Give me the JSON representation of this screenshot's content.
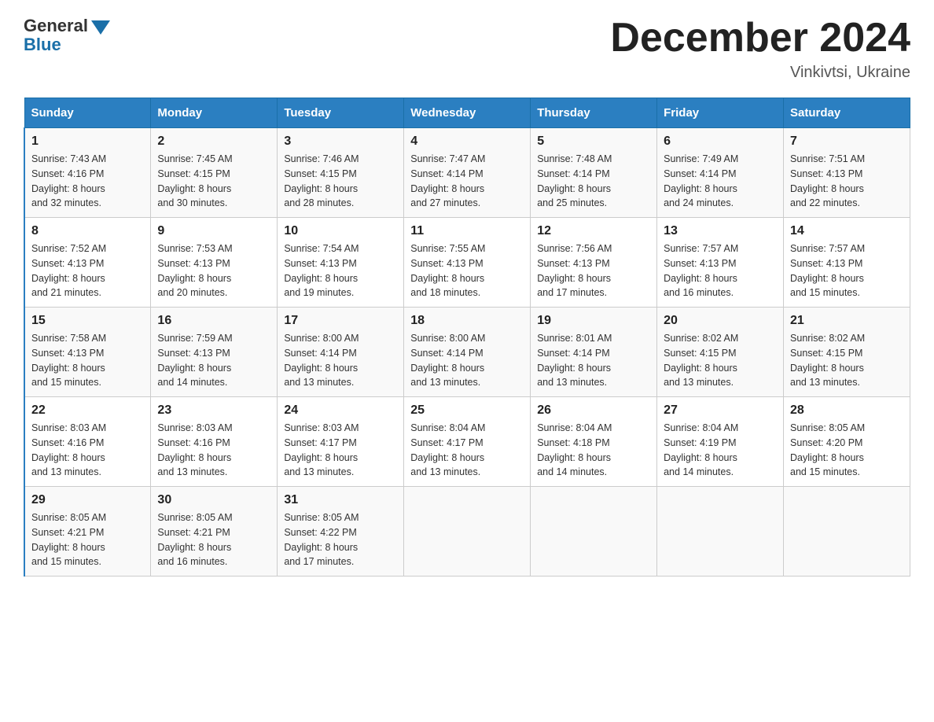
{
  "header": {
    "logo_general": "General",
    "logo_blue": "Blue",
    "month_title": "December 2024",
    "location": "Vinkivtsi, Ukraine"
  },
  "days_of_week": [
    "Sunday",
    "Monday",
    "Tuesday",
    "Wednesday",
    "Thursday",
    "Friday",
    "Saturday"
  ],
  "weeks": [
    [
      {
        "day": "1",
        "sunrise": "7:43 AM",
        "sunset": "4:16 PM",
        "daylight": "8 hours and 32 minutes."
      },
      {
        "day": "2",
        "sunrise": "7:45 AM",
        "sunset": "4:15 PM",
        "daylight": "8 hours and 30 minutes."
      },
      {
        "day": "3",
        "sunrise": "7:46 AM",
        "sunset": "4:15 PM",
        "daylight": "8 hours and 28 minutes."
      },
      {
        "day": "4",
        "sunrise": "7:47 AM",
        "sunset": "4:14 PM",
        "daylight": "8 hours and 27 minutes."
      },
      {
        "day": "5",
        "sunrise": "7:48 AM",
        "sunset": "4:14 PM",
        "daylight": "8 hours and 25 minutes."
      },
      {
        "day": "6",
        "sunrise": "7:49 AM",
        "sunset": "4:14 PM",
        "daylight": "8 hours and 24 minutes."
      },
      {
        "day": "7",
        "sunrise": "7:51 AM",
        "sunset": "4:13 PM",
        "daylight": "8 hours and 22 minutes."
      }
    ],
    [
      {
        "day": "8",
        "sunrise": "7:52 AM",
        "sunset": "4:13 PM",
        "daylight": "8 hours and 21 minutes."
      },
      {
        "day": "9",
        "sunrise": "7:53 AM",
        "sunset": "4:13 PM",
        "daylight": "8 hours and 20 minutes."
      },
      {
        "day": "10",
        "sunrise": "7:54 AM",
        "sunset": "4:13 PM",
        "daylight": "8 hours and 19 minutes."
      },
      {
        "day": "11",
        "sunrise": "7:55 AM",
        "sunset": "4:13 PM",
        "daylight": "8 hours and 18 minutes."
      },
      {
        "day": "12",
        "sunrise": "7:56 AM",
        "sunset": "4:13 PM",
        "daylight": "8 hours and 17 minutes."
      },
      {
        "day": "13",
        "sunrise": "7:57 AM",
        "sunset": "4:13 PM",
        "daylight": "8 hours and 16 minutes."
      },
      {
        "day": "14",
        "sunrise": "7:57 AM",
        "sunset": "4:13 PM",
        "daylight": "8 hours and 15 minutes."
      }
    ],
    [
      {
        "day": "15",
        "sunrise": "7:58 AM",
        "sunset": "4:13 PM",
        "daylight": "8 hours and 15 minutes."
      },
      {
        "day": "16",
        "sunrise": "7:59 AM",
        "sunset": "4:13 PM",
        "daylight": "8 hours and 14 minutes."
      },
      {
        "day": "17",
        "sunrise": "8:00 AM",
        "sunset": "4:14 PM",
        "daylight": "8 hours and 13 minutes."
      },
      {
        "day": "18",
        "sunrise": "8:00 AM",
        "sunset": "4:14 PM",
        "daylight": "8 hours and 13 minutes."
      },
      {
        "day": "19",
        "sunrise": "8:01 AM",
        "sunset": "4:14 PM",
        "daylight": "8 hours and 13 minutes."
      },
      {
        "day": "20",
        "sunrise": "8:02 AM",
        "sunset": "4:15 PM",
        "daylight": "8 hours and 13 minutes."
      },
      {
        "day": "21",
        "sunrise": "8:02 AM",
        "sunset": "4:15 PM",
        "daylight": "8 hours and 13 minutes."
      }
    ],
    [
      {
        "day": "22",
        "sunrise": "8:03 AM",
        "sunset": "4:16 PM",
        "daylight": "8 hours and 13 minutes."
      },
      {
        "day": "23",
        "sunrise": "8:03 AM",
        "sunset": "4:16 PM",
        "daylight": "8 hours and 13 minutes."
      },
      {
        "day": "24",
        "sunrise": "8:03 AM",
        "sunset": "4:17 PM",
        "daylight": "8 hours and 13 minutes."
      },
      {
        "day": "25",
        "sunrise": "8:04 AM",
        "sunset": "4:17 PM",
        "daylight": "8 hours and 13 minutes."
      },
      {
        "day": "26",
        "sunrise": "8:04 AM",
        "sunset": "4:18 PM",
        "daylight": "8 hours and 14 minutes."
      },
      {
        "day": "27",
        "sunrise": "8:04 AM",
        "sunset": "4:19 PM",
        "daylight": "8 hours and 14 minutes."
      },
      {
        "day": "28",
        "sunrise": "8:05 AM",
        "sunset": "4:20 PM",
        "daylight": "8 hours and 15 minutes."
      }
    ],
    [
      {
        "day": "29",
        "sunrise": "8:05 AM",
        "sunset": "4:21 PM",
        "daylight": "8 hours and 15 minutes."
      },
      {
        "day": "30",
        "sunrise": "8:05 AM",
        "sunset": "4:21 PM",
        "daylight": "8 hours and 16 minutes."
      },
      {
        "day": "31",
        "sunrise": "8:05 AM",
        "sunset": "4:22 PM",
        "daylight": "8 hours and 17 minutes."
      },
      null,
      null,
      null,
      null
    ]
  ],
  "labels": {
    "sunrise": "Sunrise:",
    "sunset": "Sunset:",
    "daylight": "Daylight:"
  }
}
